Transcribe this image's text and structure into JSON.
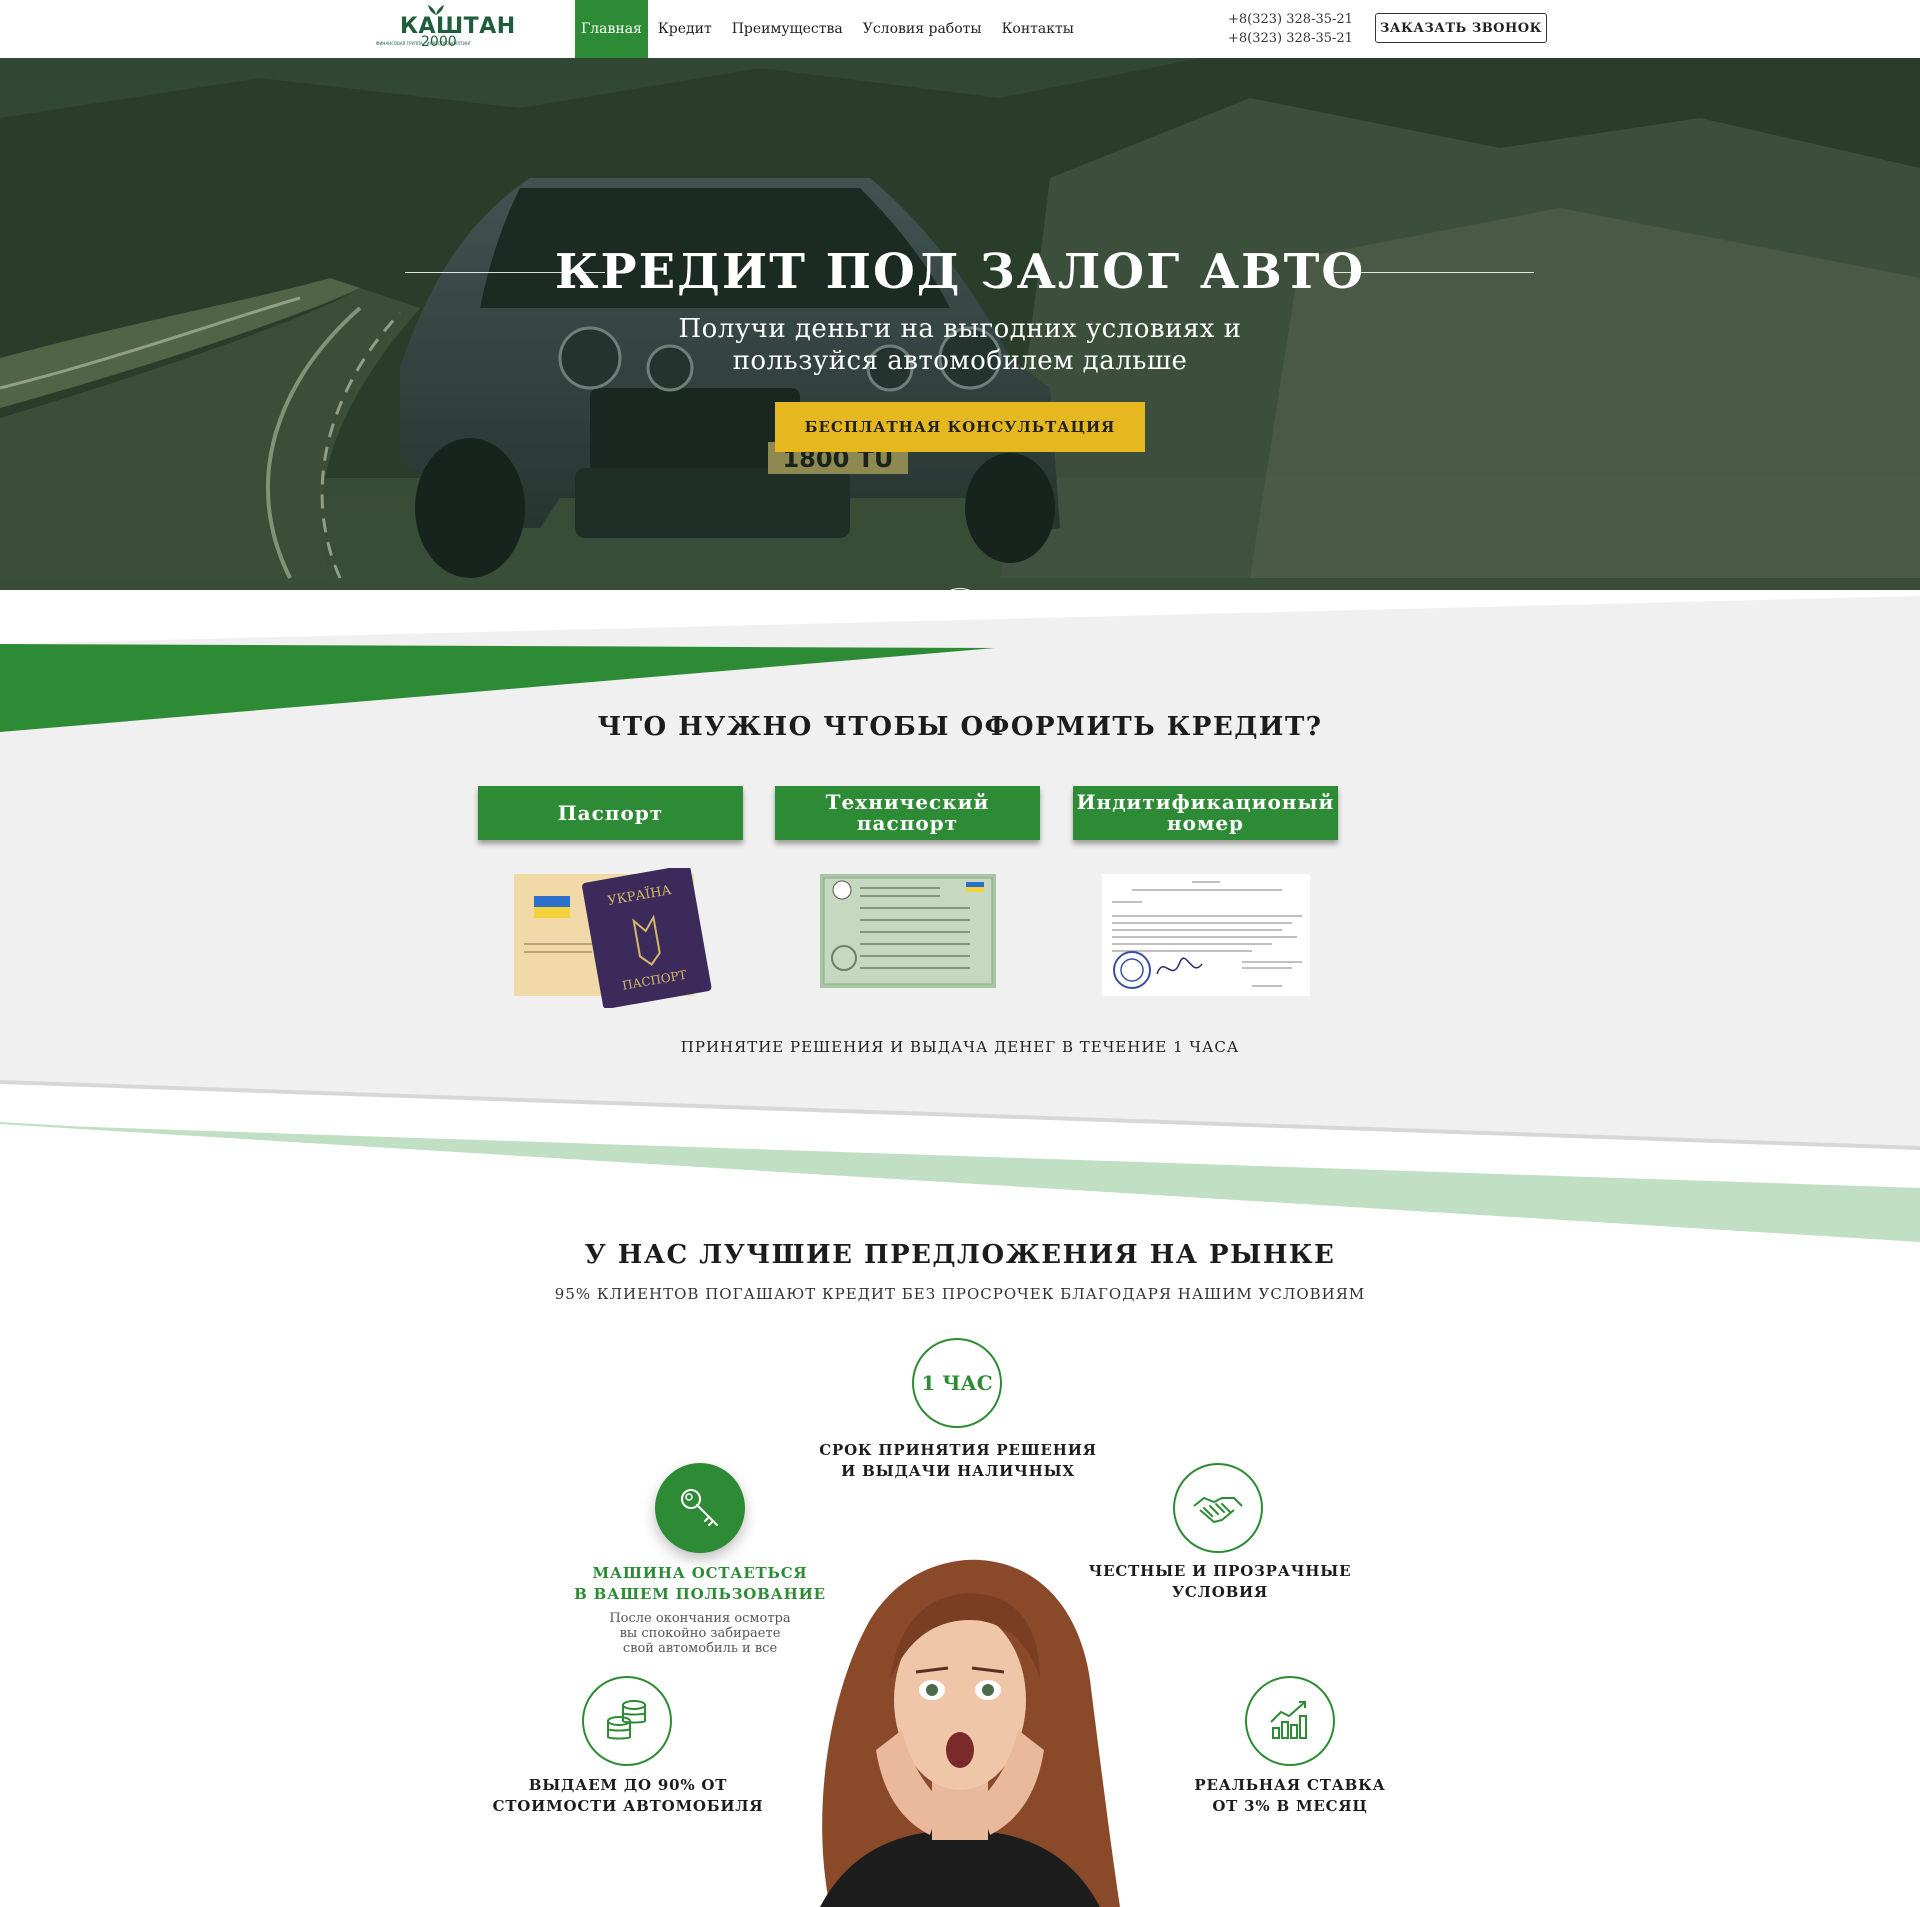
{
  "header": {
    "logo_brand": "КАШТАН",
    "logo_number": "2000",
    "logo_tagline": "ФИНАНСОВАЯ ГРУППА · ИНВЕСТКОНСАЛТИНГ",
    "nav": [
      "Главная",
      "Кредит",
      "Преимущества",
      "Условия работы",
      "Контакты"
    ],
    "active_nav": "Главная",
    "phones": [
      "+8(323) 328-35-21",
      "+8(323) 328-35-21"
    ],
    "call_button": "ЗАКАЗАТЬ ЗВОНОК"
  },
  "hero": {
    "title": "КРЕДИТ ПОД ЗАЛОГ АВТО",
    "subtitle_line1": "Получи деньги на выгодних условиях и",
    "subtitle_line2": "пользуйся автомобилем дальше",
    "cta": "БЕСПЛАТНАЯ КОНСУЛЬТАЦИЯ",
    "plate": "1800 TU",
    "scroll_icon": "chevron-down-icon"
  },
  "requirements": {
    "title": "ЧТО НУЖНО ЧТОБЫ ОФОРМИТЬ КРЕДИТ?",
    "docs": [
      {
        "label": "Паспорт"
      },
      {
        "label_line1": "Технический",
        "label_line2": "паспорт"
      },
      {
        "label_line1": "Индитификационый",
        "label_line2": "номер"
      }
    ],
    "passport_cover_top": "УКРАЇНА",
    "passport_cover_bottom": "ПАСПОРТ",
    "note": "ПРИНЯТИЕ РЕШЕНИЯ И ВЫДАЧА ДЕНЕГ В ТЕЧЕНИЕ 1 ЧАСА"
  },
  "offers": {
    "title": "У НАС ЛУЧШИЕ ПРЕДЛОЖЕНИЯ НА РЫНКЕ",
    "subtitle": "95% КЛИЕНТОВ ПОГАШАЮТ КРЕДИТ БЕЗ ПРОСРОЧЕК БЛАГОДАРЯ НАШИМ УСЛОВИЯМ",
    "features": [
      {
        "badge": "1 ЧАС",
        "line1": "СРОК ПРИНЯТИЯ РЕШЕНИЯ",
        "line2": "И ВЫДАЧИ НАЛИЧНЫХ"
      },
      {
        "icon": "key-icon",
        "line1": "МАШИНА ОСТАЕТЬСЯ",
        "line2": "В ВАШЕМ ПОЛЬЗОВАНИЕ",
        "desc1": "После окончания осмотра",
        "desc2": "вы спокойно забираете",
        "desc3": "свой автомобиль и все"
      },
      {
        "icon": "handshake-icon",
        "line1": "ЧЕСТНЫЕ И ПРОЗРАЧНЫЕ",
        "line2": "УСЛОВИЯ"
      },
      {
        "icon": "coins-icon",
        "line1": "ВЫДАЕМ ДО 90% ОТ",
        "line2": "СТОИМОСТИ АВТОМОБИЛЯ"
      },
      {
        "icon": "growth-chart-icon",
        "line1": "РЕАЛЬНАЯ СТАВКА",
        "line2": "ОТ 3% В МЕСЯЦ"
      }
    ]
  },
  "colors": {
    "brand_green": "#2e8b35",
    "light_green": "#c1dfc2",
    "cta_yellow": "#e5b820",
    "section_gray": "#f0f0f0"
  }
}
